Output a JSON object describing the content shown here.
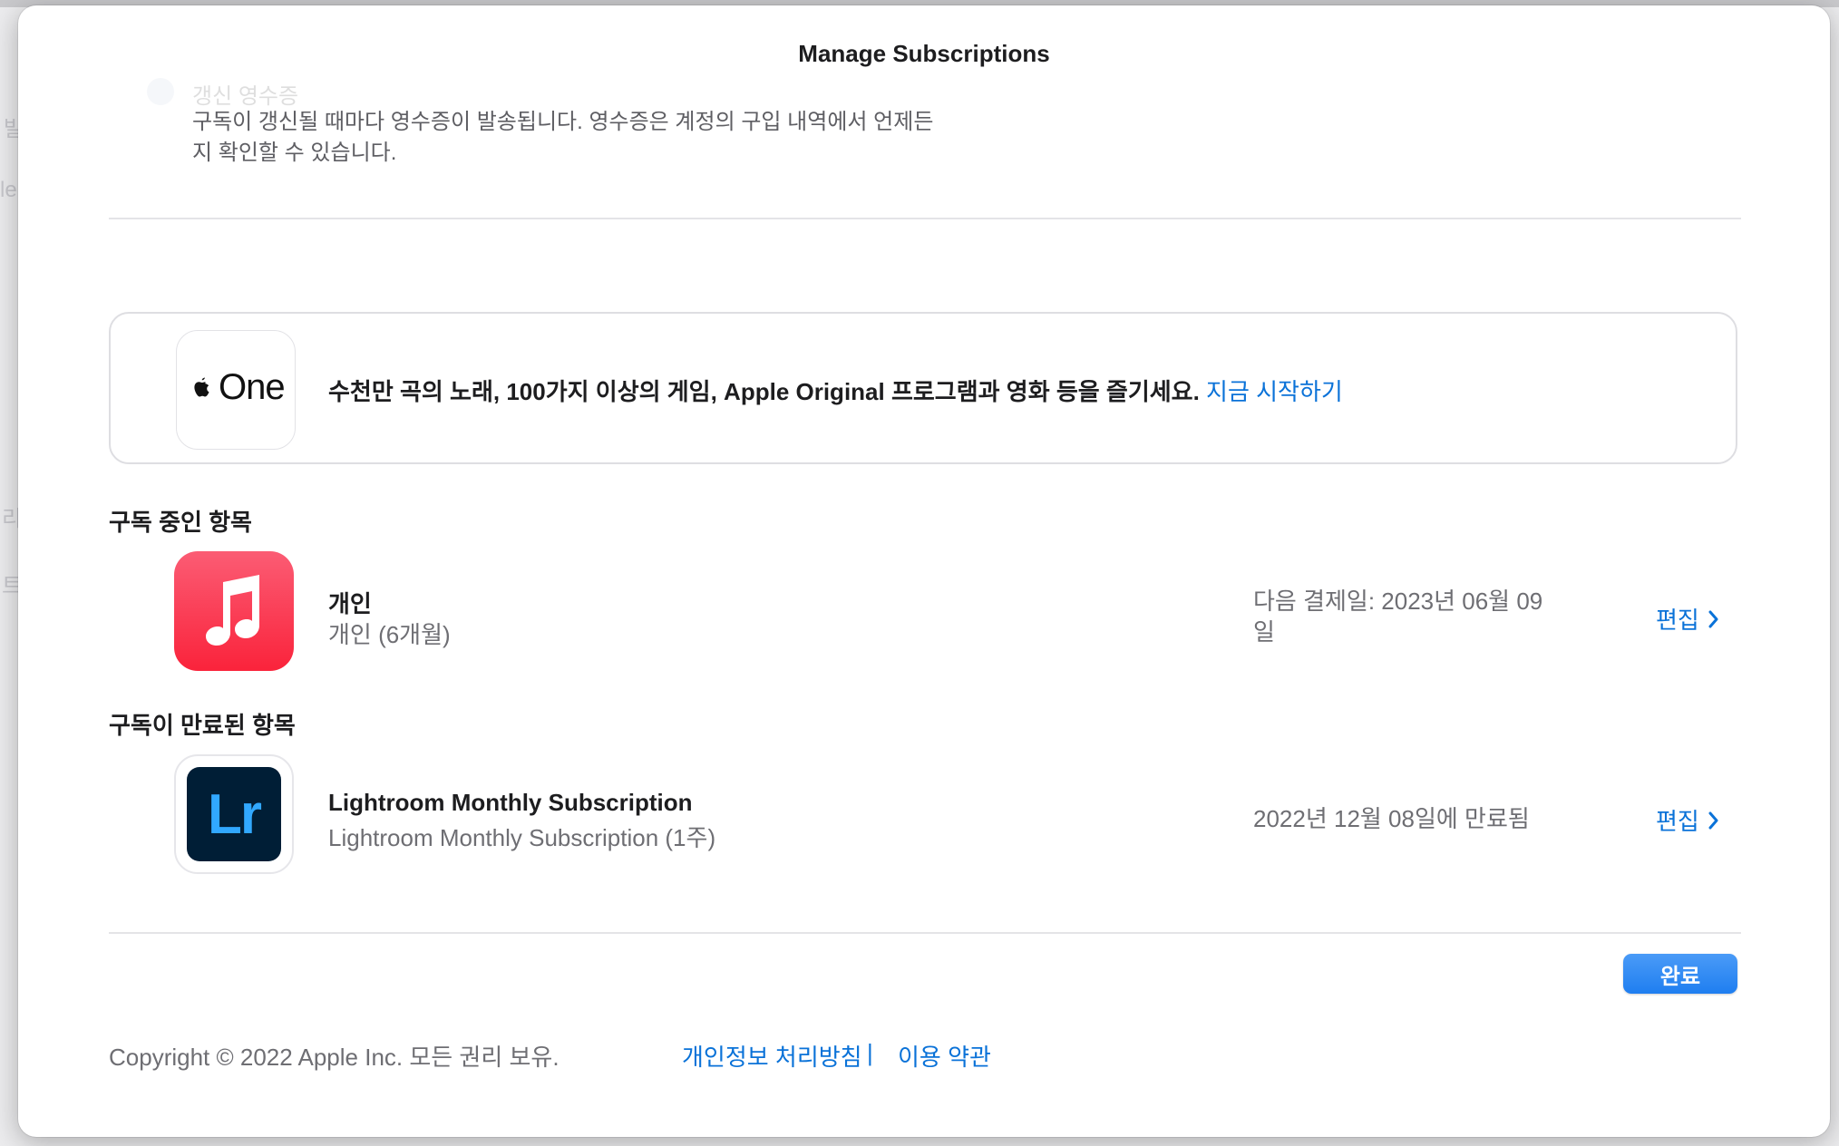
{
  "background": {
    "ghost_letters": [
      "발",
      "le",
      "리",
      "트"
    ]
  },
  "sheet": {
    "title": "Manage Subscriptions"
  },
  "renewal": {
    "title": "갱신 영수증",
    "description": "구독이 갱신될 때마다 영수증이 발송됩니다. 영수증은 계정의 구입 내역에서 언제든지 확인할 수 있습니다."
  },
  "promo": {
    "logo_label": "One",
    "text": "수천만 곡의 노래, 100가지 이상의 게임, Apple Original 프로그램과 영화 등을 즐기세요.",
    "link": "지금 시작하기"
  },
  "active_section": {
    "title": "구독 중인 항목",
    "items": [
      {
        "icon": "apple-music-icon",
        "name": "개인",
        "plan": "개인 (6개월)",
        "date": "다음 결제일: 2023년 06월 09일",
        "edit_label": "편집"
      }
    ]
  },
  "expired_section": {
    "title": "구독이 만료된 항목",
    "items": [
      {
        "icon": "lightroom-icon",
        "icon_label": "Lr",
        "name": "Lightroom Monthly Subscription",
        "plan": "Lightroom Monthly Subscription (1주)",
        "date": "2022년 12월 08일에 만료됨",
        "edit_label": "편집"
      }
    ]
  },
  "actions": {
    "done_label": "완료"
  },
  "footer": {
    "copyright": "Copyright © 2022 Apple Inc. 모든 권리 보유.",
    "privacy_label": "개인정보 처리방침",
    "separator": "|",
    "terms_label": "이용 약관"
  },
  "colors": {
    "link_blue": "#0a72d8",
    "button_blue": "#1f7ef0",
    "music_red": "#fa233b",
    "lightroom_bg": "#001e36",
    "lightroom_fg": "#31a8ff"
  }
}
